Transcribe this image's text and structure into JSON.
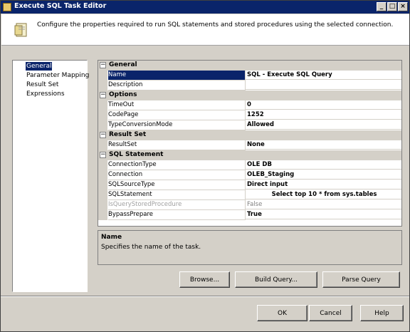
{
  "window": {
    "title": "Execute SQL Task Editor"
  },
  "header": {
    "description": "Configure the properties required to run SQL statements and stored procedures using the selected connection."
  },
  "nav": {
    "items": [
      {
        "label": "General",
        "selected": true
      },
      {
        "label": "Parameter Mapping"
      },
      {
        "label": "Result Set"
      },
      {
        "label": "Expressions"
      }
    ]
  },
  "grid": {
    "categories": [
      {
        "name": "General",
        "props": [
          {
            "name": "Name",
            "value": "SQL - Execute SQL Query"
          },
          {
            "name": "Description",
            "value": ""
          }
        ]
      },
      {
        "name": "Options",
        "props": [
          {
            "name": "TimeOut",
            "value": "0"
          },
          {
            "name": "CodePage",
            "value": "1252"
          },
          {
            "name": "TypeConversionMode",
            "value": "Allowed"
          }
        ]
      },
      {
        "name": "Result Set",
        "props": [
          {
            "name": "ResultSet",
            "value": "None"
          }
        ]
      },
      {
        "name": "SQL Statement",
        "props": [
          {
            "name": "ConnectionType",
            "value": "OLE DB"
          },
          {
            "name": "Connection",
            "value": "OLEB_Staging"
          },
          {
            "name": "SQLSourceType",
            "value": "Direct input"
          },
          {
            "name": "SQLStatement",
            "value": "Select top 10 * from sys.tables"
          },
          {
            "name": "IsQueryStoredProcedure",
            "value": "False"
          },
          {
            "name": "BypassPrepare",
            "value": "True"
          }
        ]
      }
    ]
  },
  "help": {
    "title": "Name",
    "text": "Specifies the name of the task."
  },
  "buttons": {
    "browse": "Browse...",
    "build_query": "Build Query...",
    "parse_query": "Parse Query",
    "ok": "OK",
    "cancel": "Cancel",
    "help": "Help"
  }
}
